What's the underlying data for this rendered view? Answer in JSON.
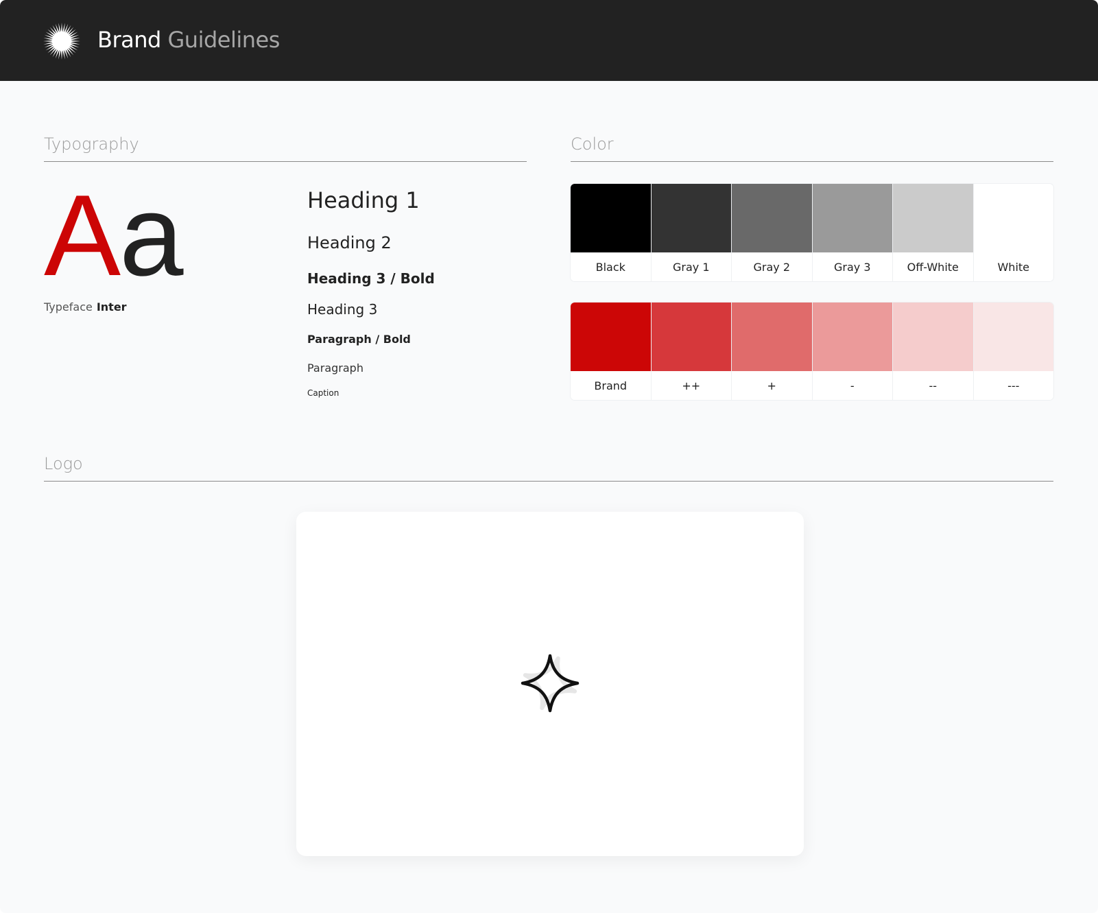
{
  "header": {
    "title_primary": "Brand",
    "title_secondary": "Guidelines",
    "icon": "starburst-icon"
  },
  "typography": {
    "section_title": "Typography",
    "specimen_upper": "A",
    "specimen_lower": "a",
    "typeface_label": "Typeface",
    "typeface_name": "Inter",
    "samples": {
      "heading1": "Heading 1",
      "heading2": "Heading 2",
      "heading3_bold": "Heading 3 / Bold",
      "heading3": "Heading 3",
      "paragraph_bold": "Paragraph / Bold",
      "paragraph": "Paragraph",
      "caption": "Caption"
    }
  },
  "color": {
    "section_title": "Color",
    "neutrals": [
      {
        "label": "Black",
        "hex": "#000000"
      },
      {
        "label": "Gray 1",
        "hex": "#333333"
      },
      {
        "label": "Gray 2",
        "hex": "#696969"
      },
      {
        "label": "Gray 3",
        "hex": "#9a9a9a"
      },
      {
        "label": "Off-White",
        "hex": "#cbcbcb"
      },
      {
        "label": "White",
        "hex": "#ffffff"
      }
    ],
    "brand": [
      {
        "label": "Brand",
        "hex": "#cc0606"
      },
      {
        "label": "++",
        "hex": "#d6383b"
      },
      {
        "label": "+",
        "hex": "#e06b6b"
      },
      {
        "label": "-",
        "hex": "#eb9a9a"
      },
      {
        "label": "--",
        "hex": "#f5cccc"
      },
      {
        "label": "---",
        "hex": "#f9e6e6"
      }
    ]
  },
  "logo": {
    "section_title": "Logo",
    "icon": "sparkle-outline-icon"
  }
}
